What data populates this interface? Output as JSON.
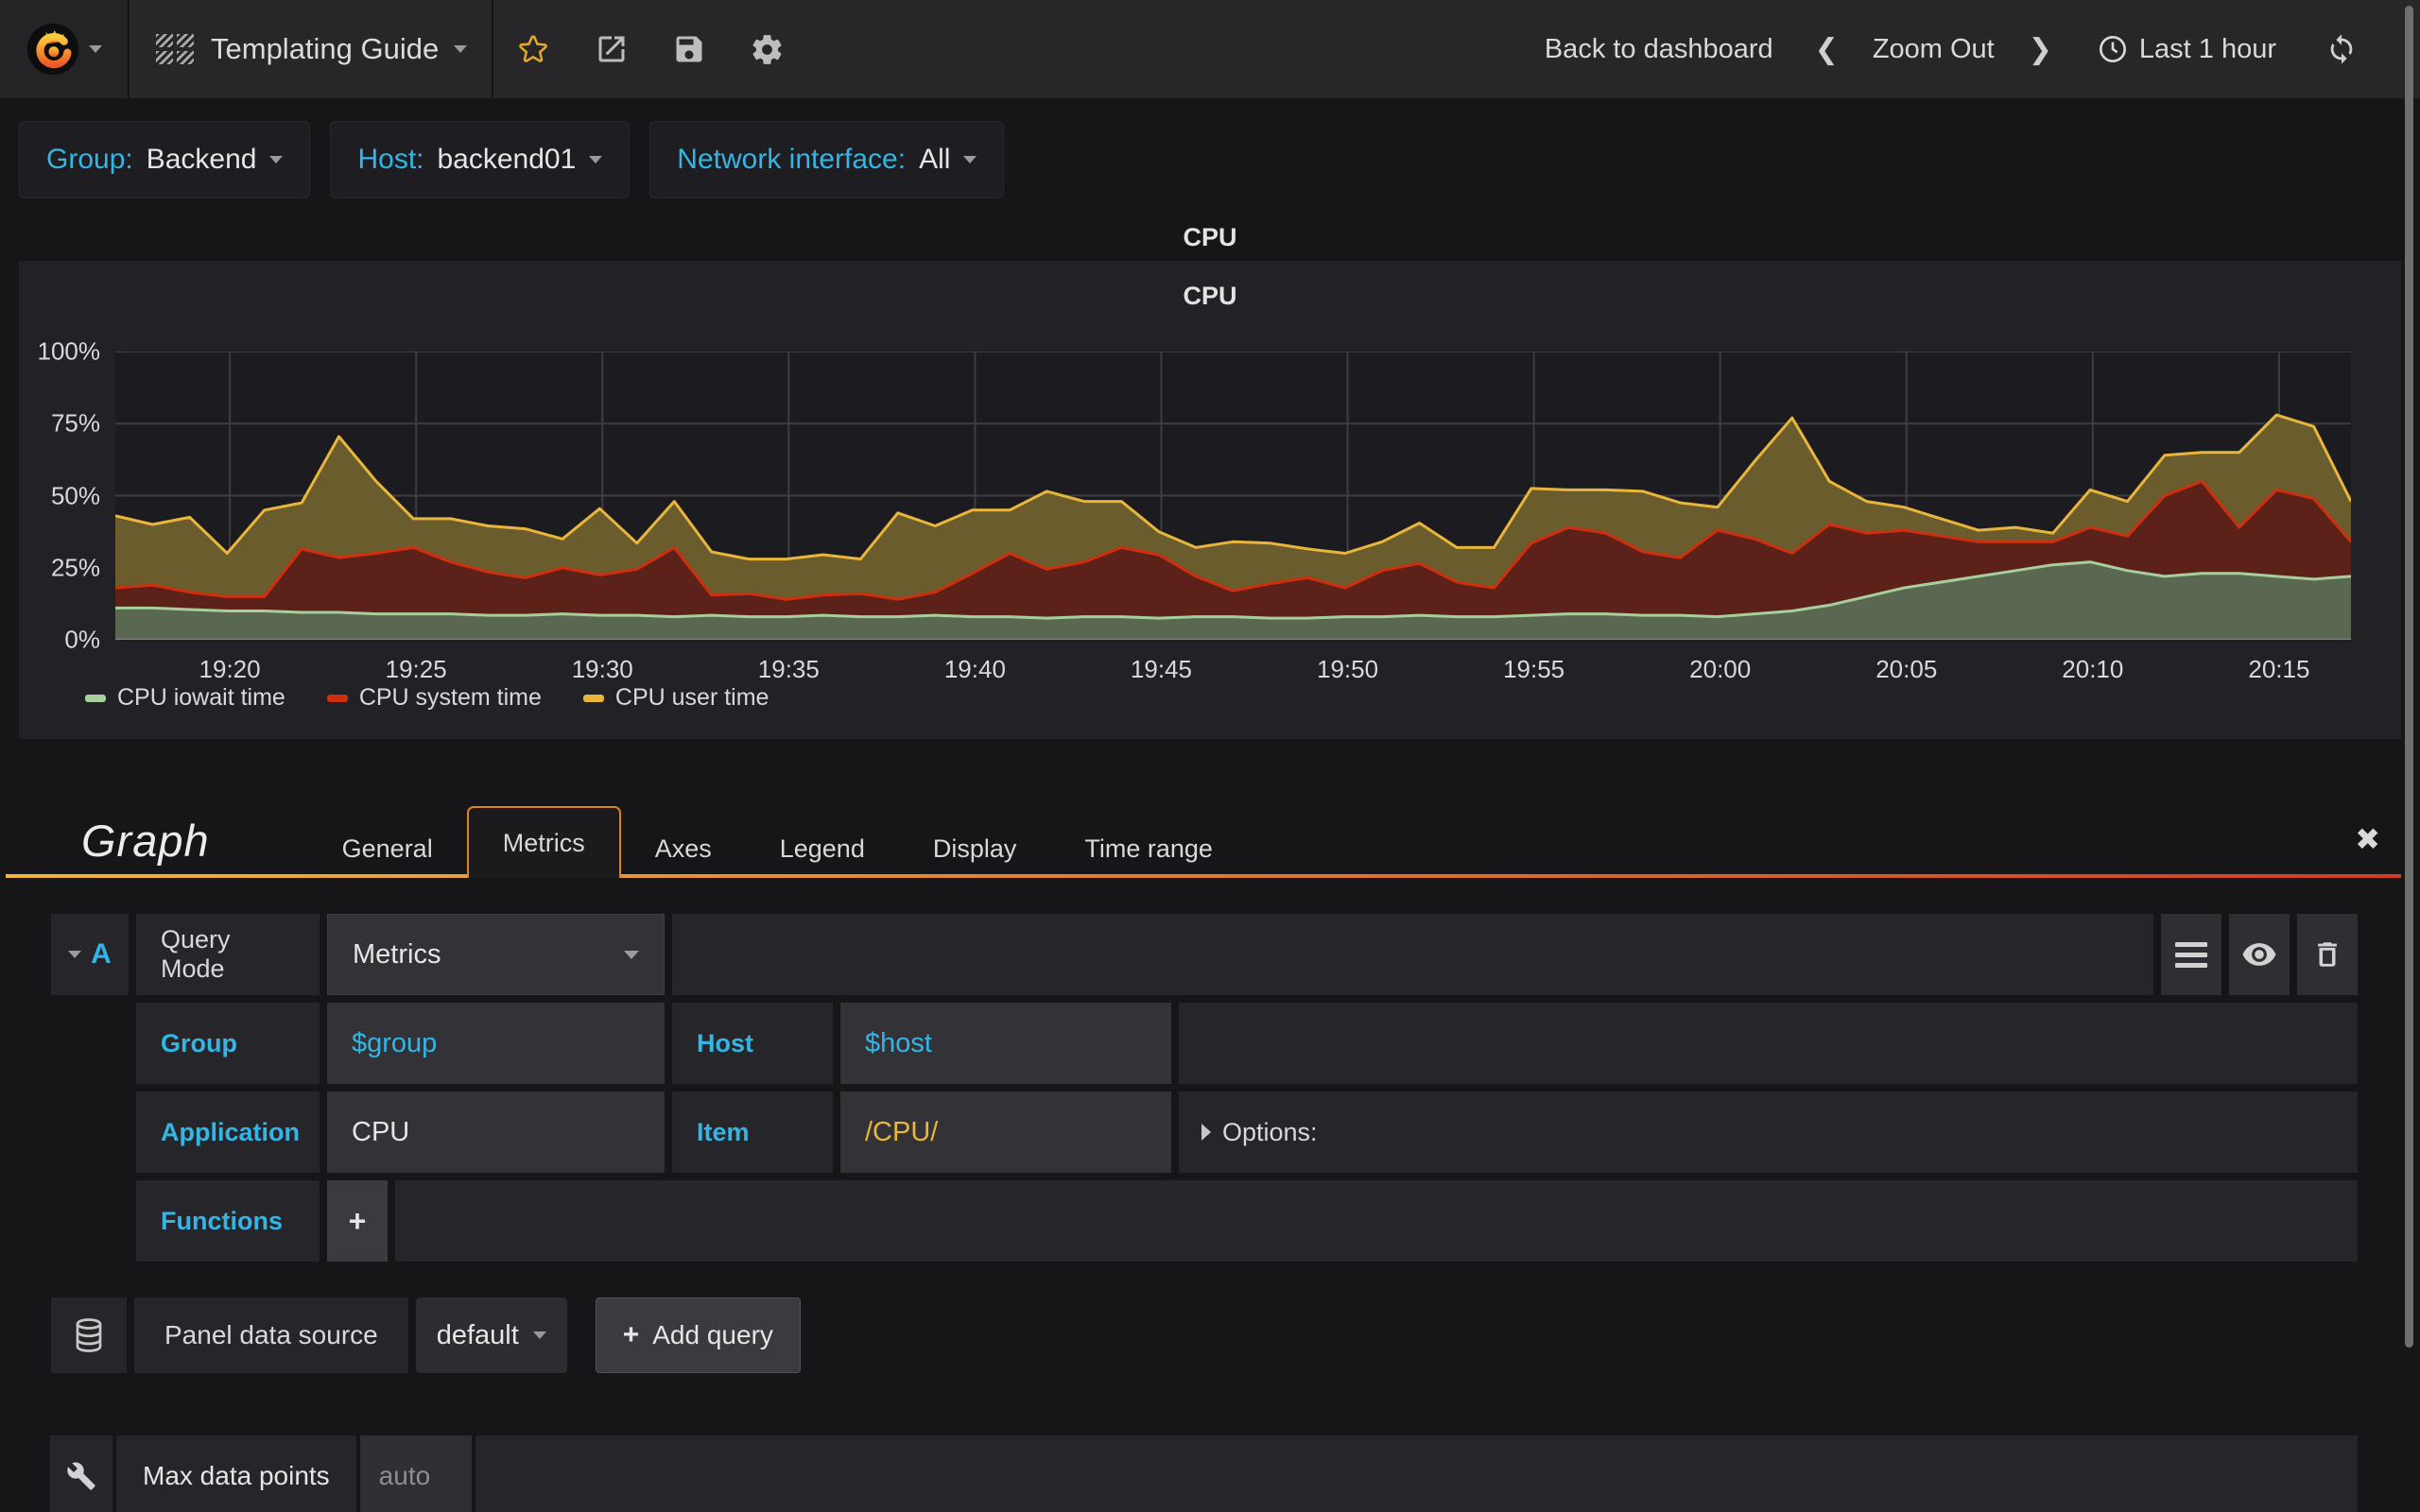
{
  "navbar": {
    "title": "Templating Guide",
    "back_to_dashboard": "Back to dashboard",
    "zoom_out": "Zoom Out",
    "time_range": "Last 1 hour"
  },
  "variables": [
    {
      "label": "Group:",
      "value": "Backend"
    },
    {
      "label": "Host:",
      "value": "backend01"
    },
    {
      "label": "Network interface:",
      "value": "All"
    }
  ],
  "panel": {
    "title": "CPU"
  },
  "chart_data": {
    "type": "area",
    "stacked": true,
    "title": "CPU",
    "ylabel": "",
    "xlabel": "",
    "ylim": [
      0,
      100
    ],
    "unit": "percent",
    "grid": true,
    "legend_position": "bottom",
    "y_ticks": [
      "100%",
      "75%",
      "50%",
      "25%",
      "0%"
    ],
    "x_ticks": [
      "19:20",
      "19:25",
      "19:30",
      "19:35",
      "19:40",
      "19:45",
      "19:50",
      "19:55",
      "20:00",
      "20:05",
      "20:10",
      "20:15"
    ],
    "x_range": [
      "19:17",
      "20:17"
    ],
    "tick_start_frac": 0.0512,
    "tick_step_frac": 0.08333,
    "series": [
      {
        "name": "CPU iowait time",
        "line_color": "#a7cf9b",
        "fill_color": "#5a6852",
        "values": [
          11,
          11,
          10.5,
          10,
          10,
          9.5,
          9.5,
          9,
          9,
          9,
          8.5,
          8.5,
          9,
          8.5,
          8.5,
          8,
          8.5,
          8,
          8,
          8.5,
          8,
          8,
          8.5,
          8,
          8,
          7.5,
          8,
          8,
          7.5,
          8,
          8,
          7.5,
          7.5,
          8,
          8,
          8.5,
          8,
          8,
          8.5,
          9,
          9,
          8.5,
          8.5,
          8,
          9,
          10,
          12,
          15,
          18,
          20,
          22,
          24,
          26,
          27,
          24,
          22,
          23,
          23,
          22,
          21,
          22
        ]
      },
      {
        "name": "CPU system time",
        "line_color": "#cf2f0e",
        "fill_color": "#5c221a",
        "values": [
          7,
          8,
          6,
          5,
          5,
          22,
          19,
          21,
          23,
          18,
          15,
          13,
          16,
          14,
          16,
          24,
          7,
          8,
          6,
          7,
          8,
          6,
          8,
          15,
          22,
          17,
          19,
          24,
          22,
          14,
          9,
          12,
          14,
          10,
          16,
          18,
          12,
          10,
          25,
          30,
          28,
          22,
          20,
          30,
          26,
          20,
          28,
          22,
          20,
          16,
          12,
          10,
          8,
          12,
          12,
          28,
          32,
          16,
          30,
          28,
          12
        ]
      },
      {
        "name": "CPU user time",
        "line_color": "#e8b63c",
        "fill_color": "#6a5c2d",
        "values": [
          25,
          21,
          26,
          15,
          30,
          16,
          42,
          25,
          10,
          15,
          16,
          17,
          10,
          23,
          9,
          16,
          15,
          12,
          14,
          14,
          12,
          30,
          23,
          22,
          15,
          27,
          21,
          16,
          8,
          10,
          17,
          14,
          10,
          12,
          10,
          14,
          12,
          14,
          19,
          13,
          15,
          21,
          19,
          8,
          27,
          47,
          15,
          11,
          8,
          6,
          4,
          5,
          3,
          13,
          12,
          14,
          10,
          26,
          26,
          25,
          14
        ]
      }
    ]
  },
  "editor": {
    "title": "Graph",
    "tabs": [
      "General",
      "Metrics",
      "Axes",
      "Legend",
      "Display",
      "Time range"
    ],
    "active_tab": "Metrics",
    "query": {
      "ref": "A",
      "mode_label": "Query Mode",
      "mode_value": "Metrics",
      "group_label": "Group",
      "group_value": "$group",
      "host_label": "Host",
      "host_value": "$host",
      "app_label": "Application",
      "app_value": "CPU",
      "item_label": "Item",
      "item_value": "/CPU/",
      "options_label": "Options:",
      "functions_label": "Functions",
      "add_function_label": "+"
    },
    "datasource": {
      "label": "Panel data source",
      "value": "default",
      "add_query_label": "Add query",
      "plus": "+"
    },
    "max_data_points": {
      "label": "Max data points",
      "placeholder": "auto"
    },
    "close_glyph": "✖"
  }
}
